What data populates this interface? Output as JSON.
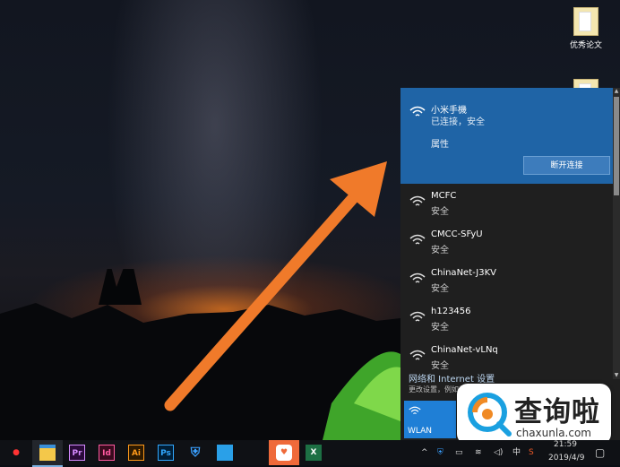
{
  "desktop": {
    "icons": [
      {
        "label": "优秀论文"
      },
      {
        "label": ""
      }
    ]
  },
  "wifi_flyout": {
    "connected": {
      "name": "小米手機",
      "status": "已连接，安全",
      "properties_label": "属性",
      "disconnect_label": "断开连接"
    },
    "networks": [
      {
        "name": "MCFC",
        "status": "安全"
      },
      {
        "name": "CMCC-SFyU",
        "status": "安全"
      },
      {
        "name": "ChinaNet-J3KV",
        "status": "安全"
      },
      {
        "name": "h123456",
        "status": "安全"
      },
      {
        "name": "ChinaNet-vLNq",
        "status": "安全"
      }
    ],
    "settings_title": "网络和 Internet 设置",
    "settings_sub": "更改设置，例如将某连接设置为按流量计费。",
    "wlan_tile_label": "WLAN"
  },
  "watermark": {
    "cn_text": "查询啦",
    "en_text": "chaxunla.com"
  },
  "taskbar": {
    "apps": [
      {
        "icon": "qq-icon",
        "label": ""
      },
      {
        "icon": "file-explorer-icon",
        "label": ""
      },
      {
        "icon": "premiere-icon",
        "label": "Pr"
      },
      {
        "icon": "indesign-icon",
        "label": "Id"
      },
      {
        "icon": "illustrator-icon",
        "label": "Ai"
      },
      {
        "icon": "photoshop-icon",
        "label": "Ps"
      },
      {
        "icon": "security-shield-icon",
        "label": ""
      },
      {
        "icon": "pinned-app-icon",
        "label": ""
      },
      {
        "icon": "heart-app-icon",
        "label": ""
      },
      {
        "icon": "excel-icon",
        "label": "X"
      }
    ],
    "tray": {
      "ime_label": "中",
      "time": "21:59",
      "date": "2019/4/9"
    }
  },
  "colors": {
    "flyout_bg": "#1f1f1f",
    "connected_bg": "#1f64a6",
    "wlan_tile": "#1f7fd6",
    "arrow": "#f07a2a"
  }
}
